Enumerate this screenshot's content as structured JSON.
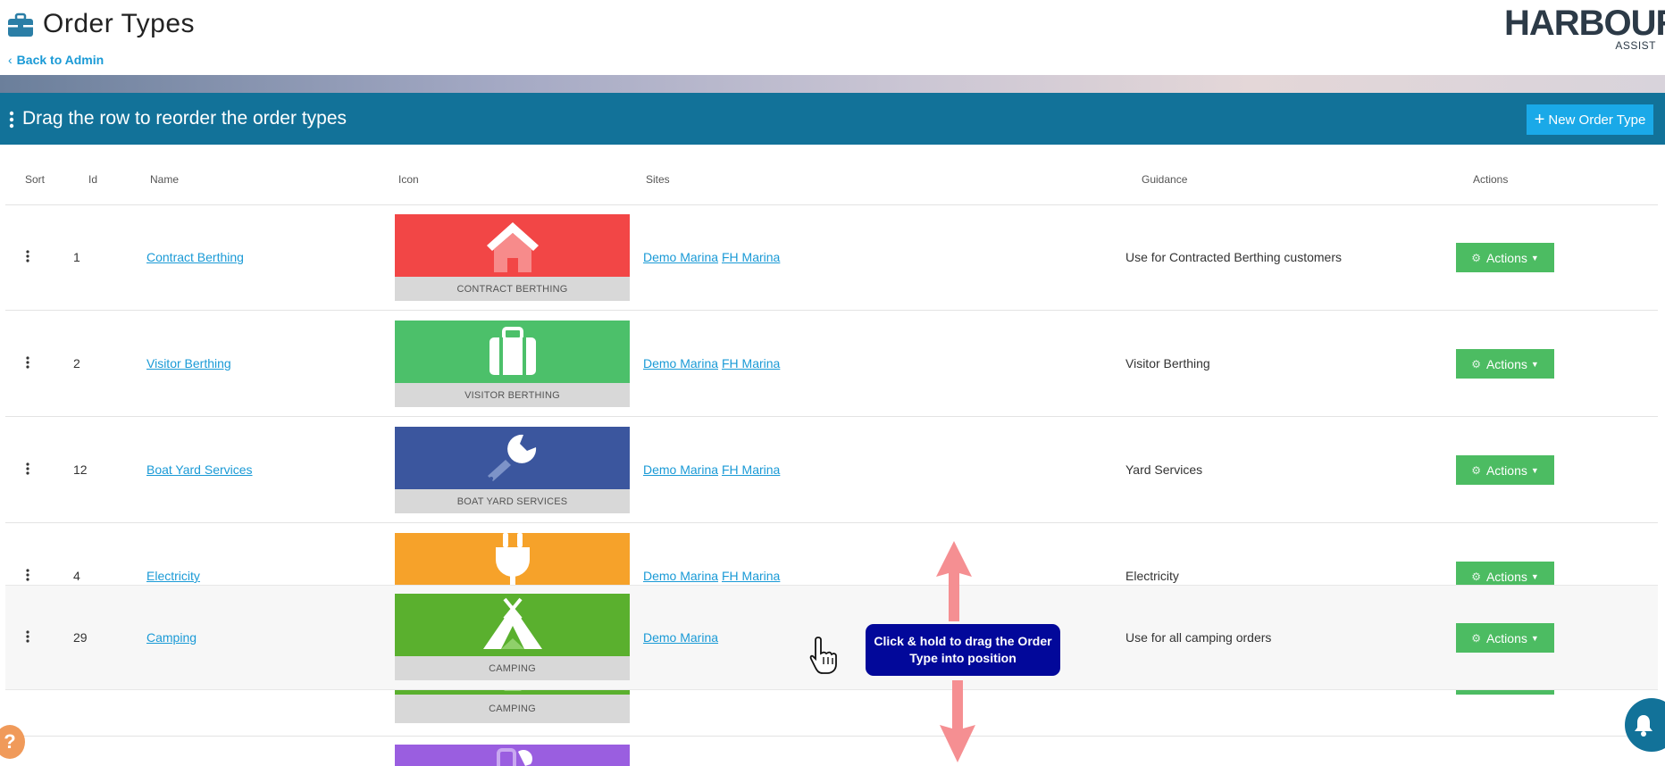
{
  "header": {
    "title": "Order Types",
    "back_label": "Back to Admin",
    "logo_main": "HARBOUR",
    "logo_sub": "ASSIST"
  },
  "toolbar": {
    "instruction": "Drag the row to reorder the order types",
    "new_button_label": "New Order Type"
  },
  "table": {
    "columns": [
      "Sort",
      "Id",
      "Name",
      "Icon",
      "Sites",
      "Guidance",
      "Actions"
    ],
    "rows": [
      {
        "id": "1",
        "name": "Contract Berthing",
        "icon_label": "CONTRACT BERTHING",
        "icon": "house-icon",
        "color": "#f24646",
        "sites": [
          "Demo Marina",
          "FH Marina"
        ],
        "guidance": "Use for Contracted Berthing customers",
        "actions_label": "Actions"
      },
      {
        "id": "2",
        "name": "Visitor Berthing",
        "icon_label": "VISITOR BERTHING",
        "icon": "suitcase-icon",
        "color": "#4cc06a",
        "sites": [
          "Demo Marina",
          "FH Marina"
        ],
        "guidance": "Visitor Berthing",
        "actions_label": "Actions"
      },
      {
        "id": "12",
        "name": "Boat Yard Services",
        "icon_label": "BOAT YARD SERVICES",
        "icon": "wrench-icon",
        "color": "#3b569e",
        "sites": [
          "Demo Marina",
          "FH Marina"
        ],
        "guidance": "Yard Services",
        "actions_label": "Actions"
      },
      {
        "id": "4",
        "name": "Electricity",
        "icon_label": "",
        "icon": "plug-icon",
        "color": "#f6a22a",
        "sites": [
          "Demo Marina",
          "FH Marina"
        ],
        "guidance": "Electricity",
        "actions_label": "Actions"
      }
    ],
    "dragging_row": {
      "id": "29",
      "name": "Camping",
      "icon_label": "CAMPING",
      "icon": "tent-icon",
      "color": "#5ab02e",
      "sites": [
        "Demo Marina"
      ],
      "guidance": "Use for all camping orders",
      "actions_label": "Actions"
    },
    "placeholder_row": {
      "icon_label": "CAMPING",
      "color": "#5ab02e"
    },
    "next_row": {
      "icon": "plug-wrench-icon",
      "color": "#9a5ee0"
    }
  },
  "overlay": {
    "tooltip": "Click & hold to drag the Order Type into position",
    "arrow_color": "#f58f92"
  },
  "badges": {
    "help": "?",
    "bell": "bell-icon"
  }
}
